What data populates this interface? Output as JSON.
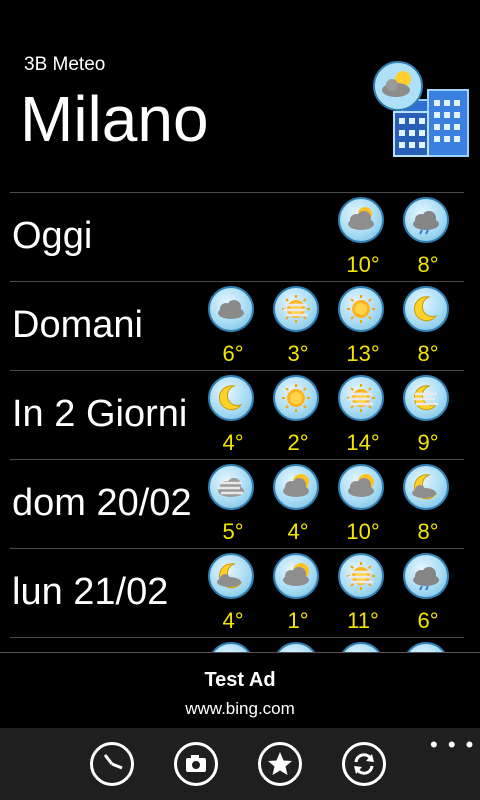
{
  "header": {
    "app_name": "3B Meteo",
    "city": "Milano",
    "city_icon": "city-weather-icon"
  },
  "rows": [
    {
      "label": "Oggi",
      "forecasts": [
        {
          "icon": "cloud-sun-icon",
          "temp": "10°"
        },
        {
          "icon": "cloud-rain-icon",
          "temp": "8°"
        }
      ]
    },
    {
      "label": "Domani",
      "forecasts": [
        {
          "icon": "cloud-icon",
          "temp": "6°"
        },
        {
          "icon": "sun-fog-icon",
          "temp": "3°"
        },
        {
          "icon": "sun-icon",
          "temp": "13°"
        },
        {
          "icon": "moon-icon",
          "temp": "8°"
        }
      ]
    },
    {
      "label": "In 2 Giorni",
      "forecasts": [
        {
          "icon": "moon-icon",
          "temp": "4°"
        },
        {
          "icon": "sun-icon",
          "temp": "2°"
        },
        {
          "icon": "sun-fog-icon",
          "temp": "14°"
        },
        {
          "icon": "moon-fog-icon",
          "temp": "9°"
        }
      ]
    },
    {
      "label": "dom 20/02",
      "forecasts": [
        {
          "icon": "cloud-fog-icon",
          "temp": "5°"
        },
        {
          "icon": "sun-cloud-icon",
          "temp": "4°"
        },
        {
          "icon": "sun-cloud-icon",
          "temp": "10°"
        },
        {
          "icon": "moon-cloud-icon",
          "temp": "8°"
        }
      ]
    },
    {
      "label": "lun 21/02",
      "forecasts": [
        {
          "icon": "moon-cloud-icon",
          "temp": "4°"
        },
        {
          "icon": "sun-cloud-icon",
          "temp": "1°"
        },
        {
          "icon": "sun-fog-icon",
          "temp": "11°"
        },
        {
          "icon": "cloud-rain-icon",
          "temp": "6°"
        }
      ]
    },
    {
      "label": "",
      "forecasts": [
        {
          "icon": "cloud-icon",
          "temp": ""
        },
        {
          "icon": "cloud-icon",
          "temp": ""
        },
        {
          "icon": "cloud-icon",
          "temp": ""
        },
        {
          "icon": "cloud-icon",
          "temp": ""
        }
      ]
    }
  ],
  "ad": {
    "title": "Test Ad",
    "url": "www.bing.com"
  },
  "appbar": {
    "buttons": [
      {
        "icon": "clock-icon"
      },
      {
        "icon": "camera-icon"
      },
      {
        "icon": "star-icon"
      },
      {
        "icon": "refresh-icon"
      }
    ],
    "more": "more-dots-icon"
  }
}
